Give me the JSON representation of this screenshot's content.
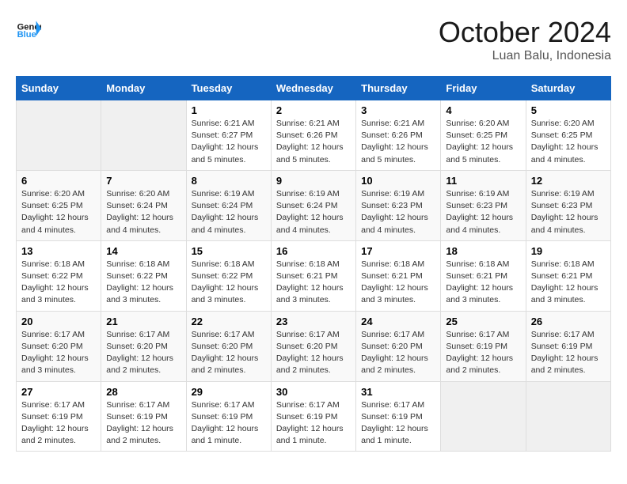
{
  "header": {
    "logo_text_general": "General",
    "logo_text_blue": "Blue",
    "month": "October 2024",
    "location": "Luan Balu, Indonesia"
  },
  "weekdays": [
    "Sunday",
    "Monday",
    "Tuesday",
    "Wednesday",
    "Thursday",
    "Friday",
    "Saturday"
  ],
  "weeks": [
    [
      {
        "day": "",
        "empty": true
      },
      {
        "day": "",
        "empty": true
      },
      {
        "day": "1",
        "sunrise": "Sunrise: 6:21 AM",
        "sunset": "Sunset: 6:27 PM",
        "daylight": "Daylight: 12 hours and 5 minutes."
      },
      {
        "day": "2",
        "sunrise": "Sunrise: 6:21 AM",
        "sunset": "Sunset: 6:26 PM",
        "daylight": "Daylight: 12 hours and 5 minutes."
      },
      {
        "day": "3",
        "sunrise": "Sunrise: 6:21 AM",
        "sunset": "Sunset: 6:26 PM",
        "daylight": "Daylight: 12 hours and 5 minutes."
      },
      {
        "day": "4",
        "sunrise": "Sunrise: 6:20 AM",
        "sunset": "Sunset: 6:25 PM",
        "daylight": "Daylight: 12 hours and 5 minutes."
      },
      {
        "day": "5",
        "sunrise": "Sunrise: 6:20 AM",
        "sunset": "Sunset: 6:25 PM",
        "daylight": "Daylight: 12 hours and 4 minutes."
      }
    ],
    [
      {
        "day": "6",
        "sunrise": "Sunrise: 6:20 AM",
        "sunset": "Sunset: 6:25 PM",
        "daylight": "Daylight: 12 hours and 4 minutes."
      },
      {
        "day": "7",
        "sunrise": "Sunrise: 6:20 AM",
        "sunset": "Sunset: 6:24 PM",
        "daylight": "Daylight: 12 hours and 4 minutes."
      },
      {
        "day": "8",
        "sunrise": "Sunrise: 6:19 AM",
        "sunset": "Sunset: 6:24 PM",
        "daylight": "Daylight: 12 hours and 4 minutes."
      },
      {
        "day": "9",
        "sunrise": "Sunrise: 6:19 AM",
        "sunset": "Sunset: 6:24 PM",
        "daylight": "Daylight: 12 hours and 4 minutes."
      },
      {
        "day": "10",
        "sunrise": "Sunrise: 6:19 AM",
        "sunset": "Sunset: 6:23 PM",
        "daylight": "Daylight: 12 hours and 4 minutes."
      },
      {
        "day": "11",
        "sunrise": "Sunrise: 6:19 AM",
        "sunset": "Sunset: 6:23 PM",
        "daylight": "Daylight: 12 hours and 4 minutes."
      },
      {
        "day": "12",
        "sunrise": "Sunrise: 6:19 AM",
        "sunset": "Sunset: 6:23 PM",
        "daylight": "Daylight: 12 hours and 4 minutes."
      }
    ],
    [
      {
        "day": "13",
        "sunrise": "Sunrise: 6:18 AM",
        "sunset": "Sunset: 6:22 PM",
        "daylight": "Daylight: 12 hours and 3 minutes."
      },
      {
        "day": "14",
        "sunrise": "Sunrise: 6:18 AM",
        "sunset": "Sunset: 6:22 PM",
        "daylight": "Daylight: 12 hours and 3 minutes."
      },
      {
        "day": "15",
        "sunrise": "Sunrise: 6:18 AM",
        "sunset": "Sunset: 6:22 PM",
        "daylight": "Daylight: 12 hours and 3 minutes."
      },
      {
        "day": "16",
        "sunrise": "Sunrise: 6:18 AM",
        "sunset": "Sunset: 6:21 PM",
        "daylight": "Daylight: 12 hours and 3 minutes."
      },
      {
        "day": "17",
        "sunrise": "Sunrise: 6:18 AM",
        "sunset": "Sunset: 6:21 PM",
        "daylight": "Daylight: 12 hours and 3 minutes."
      },
      {
        "day": "18",
        "sunrise": "Sunrise: 6:18 AM",
        "sunset": "Sunset: 6:21 PM",
        "daylight": "Daylight: 12 hours and 3 minutes."
      },
      {
        "day": "19",
        "sunrise": "Sunrise: 6:18 AM",
        "sunset": "Sunset: 6:21 PM",
        "daylight": "Daylight: 12 hours and 3 minutes."
      }
    ],
    [
      {
        "day": "20",
        "sunrise": "Sunrise: 6:17 AM",
        "sunset": "Sunset: 6:20 PM",
        "daylight": "Daylight: 12 hours and 3 minutes."
      },
      {
        "day": "21",
        "sunrise": "Sunrise: 6:17 AM",
        "sunset": "Sunset: 6:20 PM",
        "daylight": "Daylight: 12 hours and 2 minutes."
      },
      {
        "day": "22",
        "sunrise": "Sunrise: 6:17 AM",
        "sunset": "Sunset: 6:20 PM",
        "daylight": "Daylight: 12 hours and 2 minutes."
      },
      {
        "day": "23",
        "sunrise": "Sunrise: 6:17 AM",
        "sunset": "Sunset: 6:20 PM",
        "daylight": "Daylight: 12 hours and 2 minutes."
      },
      {
        "day": "24",
        "sunrise": "Sunrise: 6:17 AM",
        "sunset": "Sunset: 6:20 PM",
        "daylight": "Daylight: 12 hours and 2 minutes."
      },
      {
        "day": "25",
        "sunrise": "Sunrise: 6:17 AM",
        "sunset": "Sunset: 6:19 PM",
        "daylight": "Daylight: 12 hours and 2 minutes."
      },
      {
        "day": "26",
        "sunrise": "Sunrise: 6:17 AM",
        "sunset": "Sunset: 6:19 PM",
        "daylight": "Daylight: 12 hours and 2 minutes."
      }
    ],
    [
      {
        "day": "27",
        "sunrise": "Sunrise: 6:17 AM",
        "sunset": "Sunset: 6:19 PM",
        "daylight": "Daylight: 12 hours and 2 minutes."
      },
      {
        "day": "28",
        "sunrise": "Sunrise: 6:17 AM",
        "sunset": "Sunset: 6:19 PM",
        "daylight": "Daylight: 12 hours and 2 minutes."
      },
      {
        "day": "29",
        "sunrise": "Sunrise: 6:17 AM",
        "sunset": "Sunset: 6:19 PM",
        "daylight": "Daylight: 12 hours and 1 minute."
      },
      {
        "day": "30",
        "sunrise": "Sunrise: 6:17 AM",
        "sunset": "Sunset: 6:19 PM",
        "daylight": "Daylight: 12 hours and 1 minute."
      },
      {
        "day": "31",
        "sunrise": "Sunrise: 6:17 AM",
        "sunset": "Sunset: 6:19 PM",
        "daylight": "Daylight: 12 hours and 1 minute."
      },
      {
        "day": "",
        "empty": true
      },
      {
        "day": "",
        "empty": true
      }
    ]
  ]
}
